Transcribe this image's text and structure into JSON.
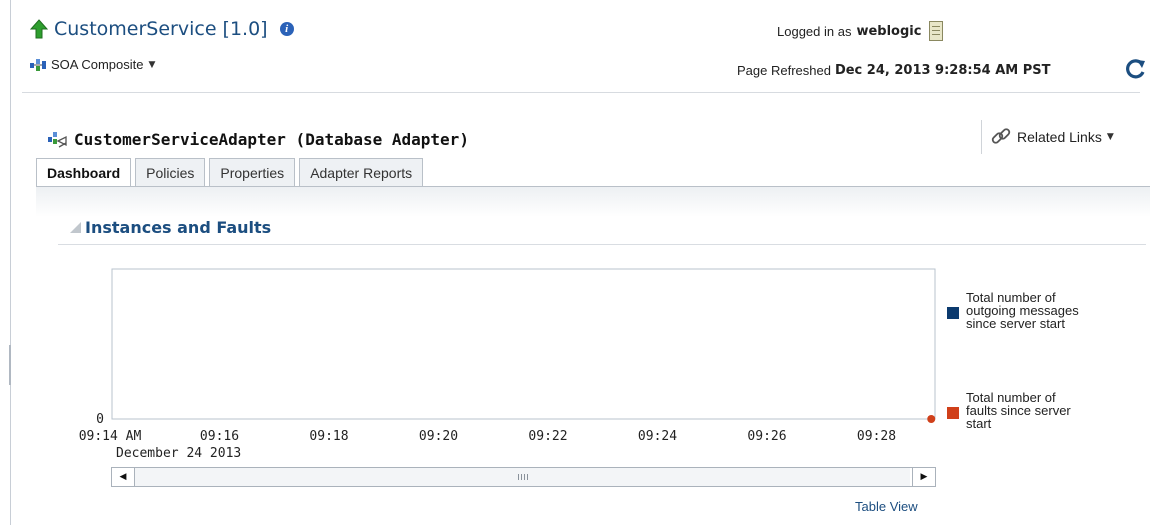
{
  "header": {
    "app_title": "CustomerService [1.0]",
    "composite_menu": "SOA Composite",
    "logged_in_prefix": "Logged in as",
    "logged_in_user": "weblogic",
    "refreshed_prefix": "Page Refreshed",
    "refreshed_time": "Dec 24, 2013 9:28:54 AM PST"
  },
  "section": {
    "title": "CustomerServiceAdapter (Database Adapter)",
    "related_links": "Related Links"
  },
  "tabs": [
    {
      "label": "Dashboard",
      "active": true
    },
    {
      "label": "Policies",
      "active": false
    },
    {
      "label": "Properties",
      "active": false
    },
    {
      "label": "Adapter Reports",
      "active": false
    }
  ],
  "panel": {
    "title": "Instances and Faults",
    "table_view_link": "Table View"
  },
  "chart_data": {
    "type": "line",
    "x_ticks": [
      "09:14 AM",
      "09:16",
      "09:18",
      "09:20",
      "09:22",
      "09:24",
      "09:26",
      "09:28"
    ],
    "x_subtitle": "December 24 2013",
    "y_ticks": [
      "0"
    ],
    "series": [
      {
        "name": "Total number of outgoing messages since server start",
        "name_lines": [
          "Total number of",
          "outgoing messages",
          "since server start"
        ],
        "color": "#0b3a6e",
        "values": []
      },
      {
        "name": "Total number of faults since server start",
        "name_lines": [
          "Total number of",
          "faults since server",
          "start"
        ],
        "color": "#d0401a",
        "values": [
          {
            "x": "09:29",
            "y": 0
          }
        ]
      }
    ],
    "legend_placement": "right"
  },
  "colors": {
    "accent": "#1c4e80",
    "up_arrow": "#2e9e2e"
  }
}
